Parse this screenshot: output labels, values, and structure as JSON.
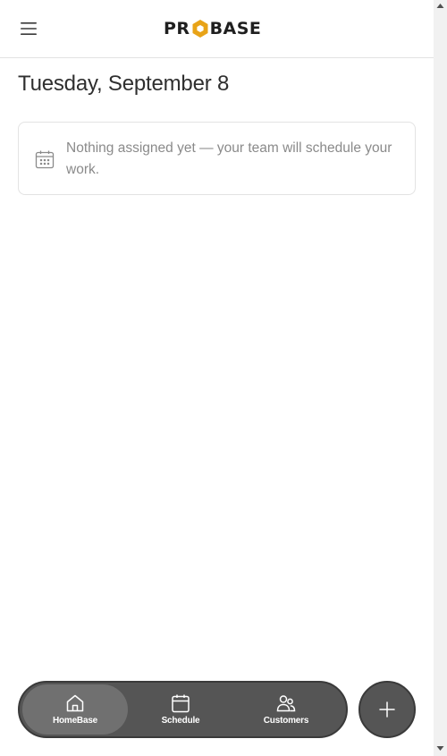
{
  "header": {
    "logo_left": "PR",
    "logo_right": "BASE",
    "brand_accent": "#E8A317"
  },
  "main": {
    "date_title": "Tuesday, September 8",
    "empty_message": "Nothing assigned yet — your team will schedule your work."
  },
  "bottom_nav": {
    "items": [
      {
        "label": "HomeBase",
        "icon": "home-icon",
        "active": true
      },
      {
        "label": "Schedule",
        "icon": "calendar-icon",
        "active": false
      },
      {
        "label": "Customers",
        "icon": "users-icon",
        "active": false
      }
    ]
  },
  "fab": {
    "icon": "plus-icon"
  },
  "colors": {
    "nav_bg": "#555555",
    "nav_active": "#707070",
    "muted_text": "#8a8a8a"
  }
}
